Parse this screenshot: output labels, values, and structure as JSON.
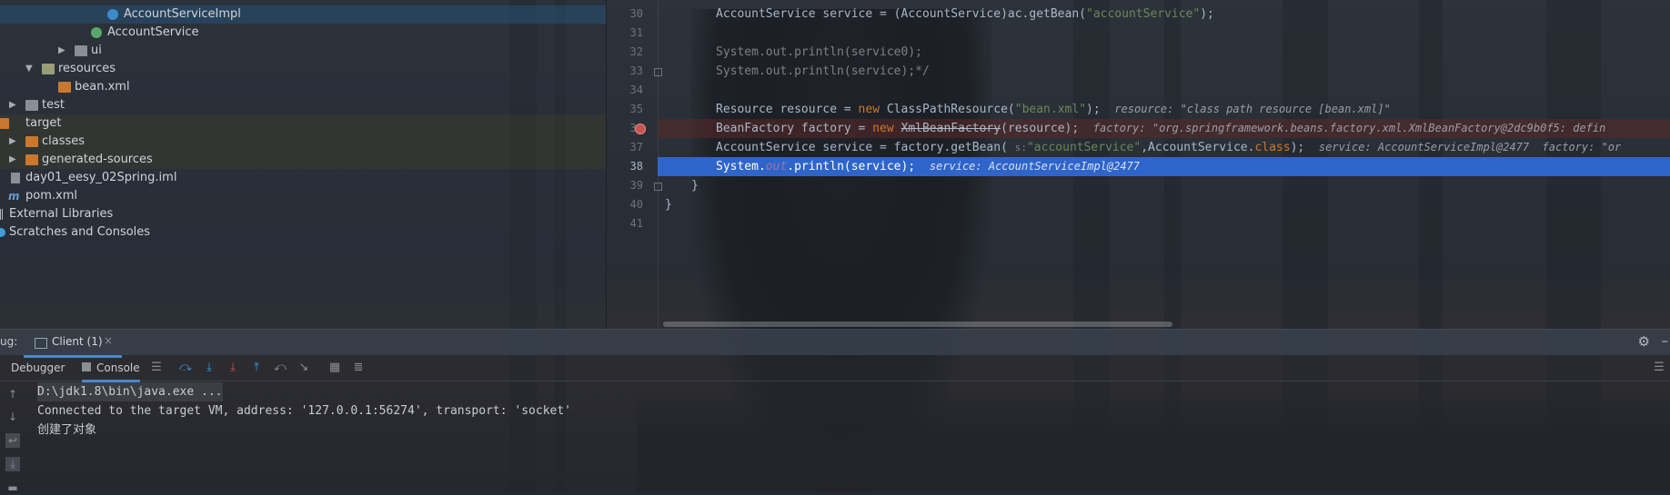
{
  "tree": {
    "items": [
      {
        "label": "AccountServiceImpl",
        "icon": "class-icon"
      },
      {
        "label": "AccountService",
        "icon": "interface-icon"
      },
      {
        "label": "ui",
        "icon": "package-icon"
      },
      {
        "label": "resources",
        "icon": "resources-folder-icon"
      },
      {
        "label": "bean.xml",
        "icon": "xml-file-icon"
      },
      {
        "label": "test",
        "icon": "folder-icon"
      },
      {
        "label": "target",
        "icon": "folder-icon"
      },
      {
        "label": "classes",
        "icon": "folder-icon"
      },
      {
        "label": "generated-sources",
        "icon": "folder-icon"
      },
      {
        "label": "day01_eesy_02Spring.iml",
        "icon": "iml-file-icon"
      },
      {
        "label": "pom.xml",
        "icon": "maven-icon"
      },
      {
        "label": "External Libraries",
        "icon": "libraries-icon"
      },
      {
        "label": "Scratches and Consoles",
        "icon": "scratches-icon"
      }
    ]
  },
  "editor": {
    "line_numbers": [
      "30",
      "31",
      "32",
      "33",
      "34",
      "35",
      "36",
      "37",
      "38",
      "39",
      "40",
      "41"
    ],
    "current_line": "38",
    "l30": {
      "a": "AccountService service = (AccountService)ac.getBean(",
      "s": "\"accountService\"",
      "b": ");"
    },
    "l32": {
      "a": "System.out.println(service0);"
    },
    "l33": {
      "a": "System.out.println(service);*/"
    },
    "l35": {
      "a": "Resource resource = ",
      "kw": "new",
      "b": " ClassPathResource(",
      "s": "\"bean.xml\"",
      "c": ");",
      "inlay": "resource: \"class path resource [bean.xml]\""
    },
    "l36": {
      "a": "BeanFactory factory = ",
      "kw": "new",
      "sp": " ",
      "strike": "XmlBeanFactory",
      "b": "(resource);",
      "inlay": "factory: \"org.springframework.beans.factory.xml.XmlBeanFactory@2dc9b0f5: defin"
    },
    "l37": {
      "a": "AccountService service = factory.getBean(",
      "hint": "s:",
      "s": "\"accountService\"",
      "b": ",AccountService.",
      "kw": "class",
      "c": ");",
      "inlay": "service: AccountServiceImpl@2477  factory: \"or"
    },
    "l38": {
      "a": "System.",
      "fld": "out",
      "b": ".println(service);",
      "inlay": "service: AccountServiceImpl@2477"
    },
    "l39": {
      "a": "}"
    },
    "l40": {
      "a": "}"
    }
  },
  "debug": {
    "label": "ug:",
    "tab_label": "Client (1)",
    "close": "×",
    "subtabs": {
      "debugger": "Debugger",
      "console": "Console"
    },
    "console_lines": [
      "D:\\jdk1.8\\bin\\java.exe ...",
      "Connected to the target VM, address: '127.0.0.1:56274', transport: 'socket'",
      "创建了对象"
    ]
  },
  "colors": {
    "keyword": "#cc7832",
    "string": "#6a8759",
    "field": "#9876aa",
    "execution_line": "#2f65ca",
    "breakpoint": "#c75450",
    "tab_underline": "#4a88c7"
  }
}
